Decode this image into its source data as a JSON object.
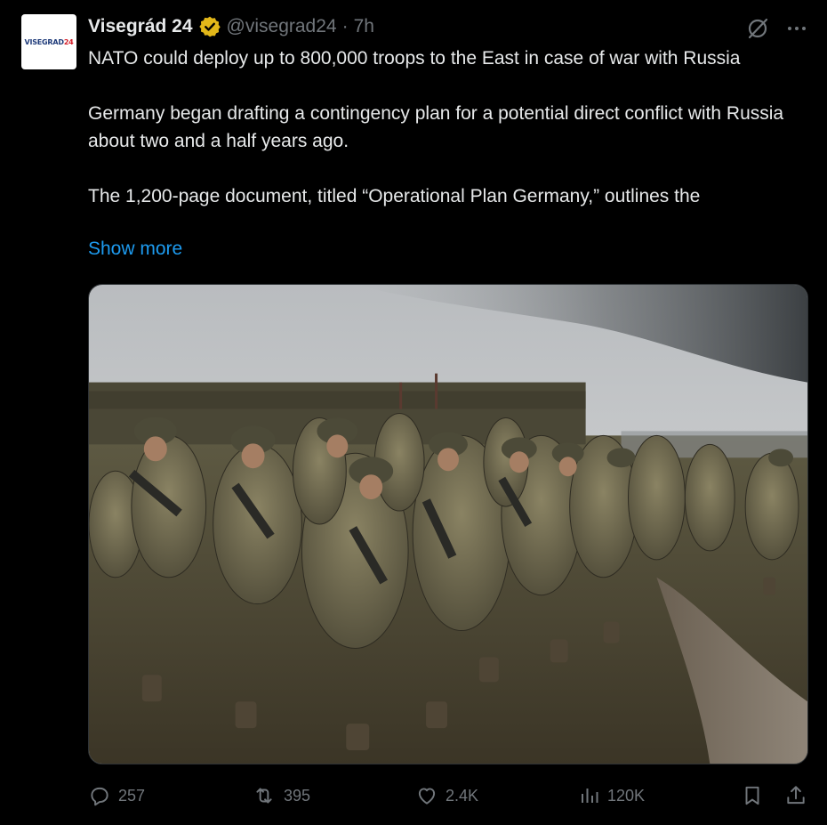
{
  "tweet": {
    "display_name": "Visegrád 24",
    "handle": "@visegrad24",
    "separator": "·",
    "time": "7h",
    "verified_icon": "verified-badge-icon",
    "avatar_text": "VISEGRAD",
    "avatar_num": "24",
    "paragraphs": [
      "NATO could deploy up to 800,000 troops to the East in case of war with Russia",
      "Germany began drafting a contingency plan for a potential direct conflict with Russia about two and a half years ago.",
      "The 1,200-page document, titled “Operational Plan Germany,” outlines the"
    ],
    "show_more": "Show more"
  },
  "actions": {
    "replies": "257",
    "reposts": "395",
    "likes": "2.4K",
    "views": "120K"
  },
  "colors": {
    "accent": "#1d9bf0",
    "muted": "#71767b",
    "text": "#e7e9ea",
    "verified_gold": "#e2b719"
  }
}
